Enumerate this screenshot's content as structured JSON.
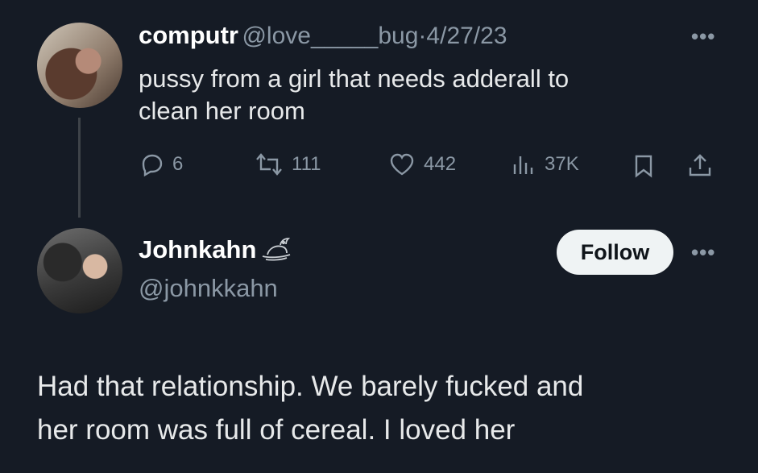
{
  "tweet1": {
    "display_name": "computr",
    "handle": "@love_____bug",
    "separator": "·",
    "date": "4/27/23",
    "text_line1": "pussy from a girl that needs adderall to",
    "text_line2": "clean her room",
    "more_icon": "more-dots-icon",
    "actions": {
      "replies": "6",
      "retweets": "111",
      "likes": "442",
      "views": "37K"
    }
  },
  "tweet2": {
    "display_name": "Johnkahn",
    "handle": "@johnkkahn",
    "follow_label": "Follow",
    "text_line1": "Had that relationship. We barely fucked and",
    "text_line2": "her room was full of cereal. I loved her"
  },
  "colors": {
    "background": "#151b25",
    "text": "#e7e9ea",
    "muted": "#8b98a5",
    "follow_bg": "#eff3f4"
  }
}
